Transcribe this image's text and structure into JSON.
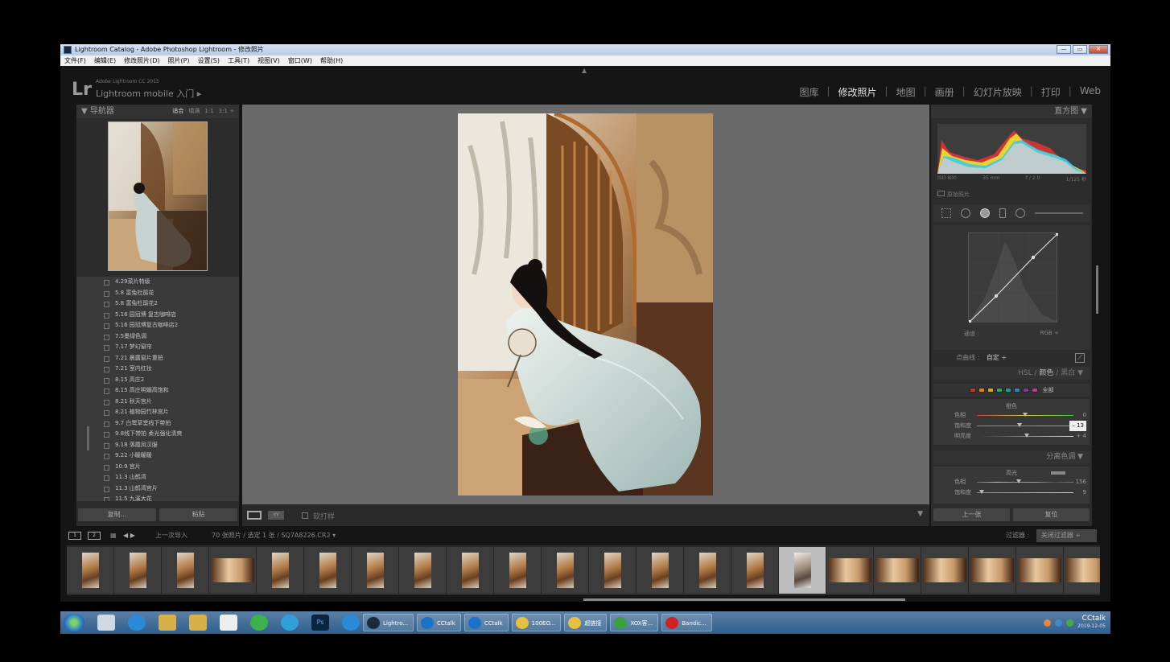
{
  "window": {
    "title": "Lightroom Catalog - Adobe Photoshop Lightroom - 修改照片",
    "controls": [
      "—",
      "▭",
      "✕"
    ]
  },
  "menubar": [
    "文件(F)",
    "编辑(E)",
    "修改照片(D)",
    "照片(P)",
    "设置(S)",
    "工具(T)",
    "视图(V)",
    "窗口(W)",
    "帮助(H)"
  ],
  "identity": {
    "logo": "Lr",
    "version": "Adobe Lightroom CC 2015",
    "mobile": "Lightroom mobile 入门 ▸"
  },
  "modules": [
    "图库",
    "修改照片",
    "地图",
    "画册",
    "幻灯片放映",
    "打印",
    "Web"
  ],
  "active_module": "修改照片",
  "navigator": {
    "title": "▼ 导航器",
    "zooms": [
      "适合",
      "填满",
      "1:1",
      "3:1 ÷"
    ],
    "active_zoom": "适合"
  },
  "presets": [
    "4.29菜片特级",
    "5.8 富兔杜鹃花",
    "5.8 富兔杜鹃花2",
    "5.16 园冠博 复古咖啡店",
    "5.16 园冠博复古咖啡店2",
    "7.5墨绿色调",
    "7.17 梦幻窗帘",
    "7.21 晨露窗片重拍",
    "7.21 室内红妆",
    "8.15 高庄2",
    "8.15 高庄明媚高饱和",
    "8.21 秋天宫片",
    "8.21 植物园竹林宫片",
    "9.7 白鹭草堂线下带拍",
    "9.8线下带拍 柔光强化清爽",
    "9.18 落霞凤汉服",
    "9.22 小暖暖暖",
    "10.9 宫片",
    "11.3 山鹤湾",
    "11.3 山鹤湾宫片",
    "11.5 九溪大花"
  ],
  "left_buttons": {
    "copy": "复制...",
    "paste": "粘贴"
  },
  "toolbar": {
    "view": "YY",
    "softproof": "软打样",
    "arrow": "▼"
  },
  "histogram": {
    "title": "直方图 ▼",
    "iso": "ISO 800",
    "focal": "35 mm",
    "aperture": "f / 2.0",
    "shutter": "1/125 秒",
    "original": "原始照片"
  },
  "tone_curve": {
    "channel_label": "通道 :",
    "channel_value": "RGB ÷",
    "point_curve_label": "点曲线 :",
    "point_curve_value": "自定 ÷"
  },
  "hsl": {
    "header_a": "HSL",
    "header_b": "颜色",
    "header_c": "黑白 ▼",
    "all": "全部",
    "swatch_colors": [
      "#c0392b",
      "#e67e22",
      "#d4ac0d",
      "#27ae60",
      "#16a085",
      "#2e86c1",
      "#7d3c98",
      "#c0398b"
    ],
    "block_title": "橙色",
    "rows": [
      {
        "label": "色相",
        "value": "0",
        "thumb": 0.5
      },
      {
        "label": "饱和度",
        "value": "– 13",
        "thumb": 0.44
      },
      {
        "label": "明亮度",
        "value": "+ 4",
        "thumb": 0.52
      }
    ]
  },
  "split_toning": {
    "title": "分离色调 ▼",
    "block_title": "高光",
    "rows": [
      {
        "label": "色相",
        "value": "156",
        "thumb": 0.43
      },
      {
        "label": "饱和度",
        "value": "9",
        "thumb": 0.05
      }
    ]
  },
  "right_buttons": {
    "previous": "上一张",
    "reset": "复位"
  },
  "filmstrip_bar": {
    "source": "上一次导入",
    "count": "70 张照片 / 选定 1 张 / SQ7A8226.CR2 ▾",
    "filter_label": "过滤器 :",
    "filter_value": "关闭过滤器 ÷"
  },
  "filmstrip": {
    "thumbs": [
      "p",
      "p",
      "p",
      "l",
      "p",
      "p",
      "p",
      "p",
      "p",
      "p",
      "p",
      "p",
      "p",
      "p",
      "p",
      "s",
      "l",
      "l",
      "l",
      "l",
      "l",
      "l"
    ]
  },
  "taskbar": {
    "tasks": [
      {
        "label": "Lightro...",
        "color": "#1b2a3a"
      },
      {
        "label": "CCtalk",
        "color": "#1a73c8"
      },
      {
        "label": "CCtalk",
        "color": "#1a73c8"
      },
      {
        "label": "100EO...",
        "color": "#e8c040"
      },
      {
        "label": "超链接",
        "color": "#e8c040"
      },
      {
        "label": "XOX客...",
        "color": "#3aa040"
      },
      {
        "label": "Bandic...",
        "color": "#d02020"
      }
    ],
    "clock_brand": "CCtalk",
    "date": "2019-12-05"
  },
  "colors": {
    "panel_bg": "#2c2c2c",
    "canvas_bg": "#6a6a6a",
    "app_bg": "#151515"
  }
}
